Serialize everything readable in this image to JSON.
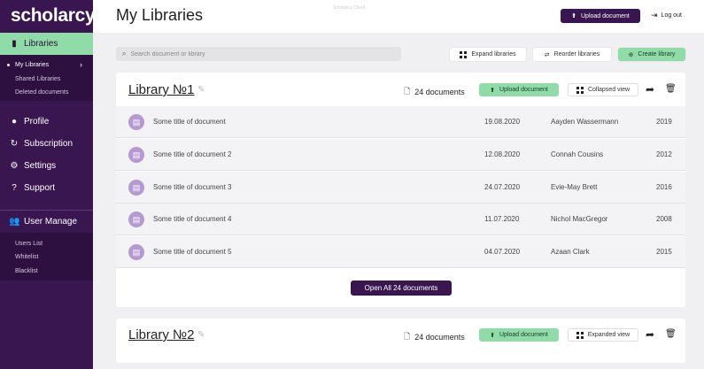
{
  "app": {
    "logo": "scholarcy",
    "faint_top_text": "Scholarcy Client"
  },
  "sidebar": {
    "libraries": "Libraries",
    "sub": [
      "My Libraries",
      "Shared Libraries",
      "Deleted documents"
    ],
    "items": [
      "Profile",
      "Subscription",
      "Settings",
      "Support"
    ],
    "user_manage": "User Manage",
    "user_sub": [
      "Users List",
      "Whitelist",
      "Blacklist"
    ]
  },
  "header": {
    "title": "My Libraries",
    "upload": "Upload document",
    "logout": "Log out"
  },
  "toolbar": {
    "search_placeholder": "Search document or library",
    "expand": "Expand libraries",
    "reorder": "Reorder libraries",
    "create": "Create library"
  },
  "libraries": [
    {
      "title": "Library №1",
      "count": "24 documents",
      "upload": "Upload document",
      "view": "Collapsed view",
      "open_all": "Open All 24 documents",
      "rows": [
        {
          "title": "Some title of document",
          "date": "19.08.2020",
          "author": "Aayden Wassermann",
          "year": "2019"
        },
        {
          "title": "Some title of document 2",
          "date": "12.08.2020",
          "author": "Connah Cousins",
          "year": "2012"
        },
        {
          "title": "Some title of document 3",
          "date": "24.07.2020",
          "author": "Evie-May Brett",
          "year": "2016"
        },
        {
          "title": "Some title of document 4",
          "date": "11.07.2020",
          "author": "Nichol MacGregor",
          "year": "2008"
        },
        {
          "title": "Some title of document 5",
          "date": "04.07.2020",
          "author": "Azaan Clark",
          "year": "2015"
        }
      ]
    },
    {
      "title": "Library №2",
      "count": "24 documents",
      "upload": "Upload document",
      "view": "Expanded view"
    }
  ],
  "colors": {
    "sidebar": "#3a1650",
    "accent": "#8fdca9",
    "doc_icon": "#b59ad1"
  }
}
